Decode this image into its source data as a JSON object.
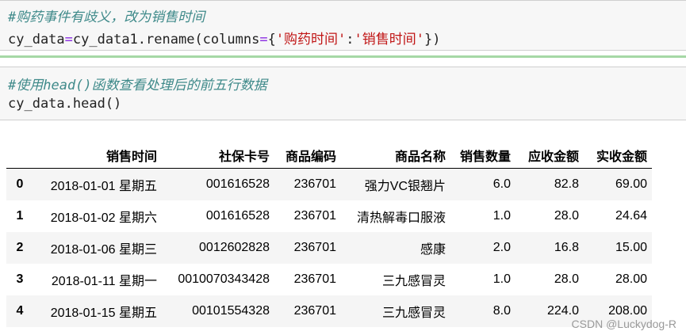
{
  "cells": [
    {
      "comment": "#购药事件有歧义，改为销售时间",
      "code": {
        "a": "cy_data",
        "eq": "=",
        "b": "cy_data1.rename(columns",
        "eq2": "=",
        "brace_open": "{",
        "key": "'购药时间'",
        "colon": ":",
        "val": "'销售时间'",
        "end": "})"
      }
    },
    {
      "comment": "#使用head()函数查看处理后的前五行数据",
      "code_plain": "cy_data.head()"
    }
  ],
  "table": {
    "columns": [
      "",
      "销售时间",
      "社保卡号",
      "商品编码",
      "商品名称",
      "销售数量",
      "应收金额",
      "实收金额"
    ],
    "rows": [
      [
        "0",
        "2018-01-01 星期五",
        "001616528",
        "236701",
        "强力VC银翘片",
        "6.0",
        "82.8",
        "69.00"
      ],
      [
        "1",
        "2018-01-02 星期六",
        "001616528",
        "236701",
        "清热解毒口服液",
        "1.0",
        "28.0",
        "24.64"
      ],
      [
        "2",
        "2018-01-06 星期三",
        "0012602828",
        "236701",
        "感康",
        "2.0",
        "16.8",
        "15.00"
      ],
      [
        "3",
        "2018-01-11 星期一",
        "0010070343428",
        "236701",
        "三九感冒灵",
        "1.0",
        "28.0",
        "28.00"
      ],
      [
        "4",
        "2018-01-15 星期五",
        "00101554328",
        "236701",
        "三九感冒灵",
        "8.0",
        "224.0",
        "208.00"
      ]
    ]
  },
  "watermark": "CSDN @Luckydog-R"
}
